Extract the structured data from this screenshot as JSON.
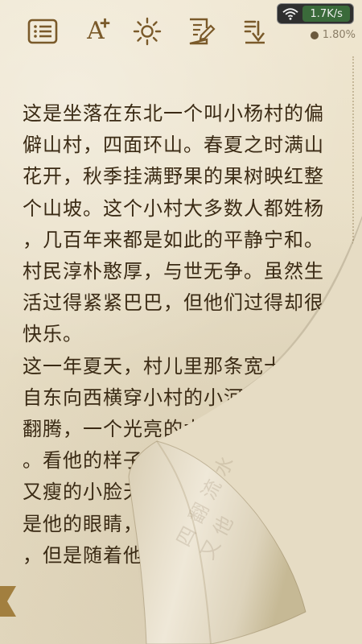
{
  "toolbar": {
    "items": [
      {
        "name": "table-of-contents",
        "icon": "list-icon"
      },
      {
        "name": "font-size",
        "icon": "font-size-icon",
        "label": "A"
      },
      {
        "name": "brightness",
        "icon": "sun-icon"
      },
      {
        "name": "bookmark-notes",
        "icon": "note-edit-icon"
      },
      {
        "name": "download",
        "icon": "download-icon"
      }
    ],
    "accent_color": "#7a5a2a"
  },
  "status": {
    "network_speed": "1.7K/s",
    "reading_progress": "1.80%"
  },
  "reader": {
    "lines": [
      "这是坐落在东北一个叫小杨村的偏",
      "僻山村，四面环山。春夏之时满山",
      "花开，秋季挂满野果的果树映红整",
      "个山坡。这个小村大多数人都姓杨",
      "，几百年来都是如此的平静宁和。",
      "村民淳朴憨厚，与世无争。虽然生",
      "活过得紧紧巴巴，但他们过得却很",
      "快乐。",
      "这一年夏天，村儿里那条宽十多往",
      "自东向西横穿小村的小河，出现在",
      "翻腾，一个光亮的水声。",
      "。看他的样子，从地上看去，",
      "又瘦的小脸天，就是这样的，",
      "是他的眼睛，大，和杨美丽上过床",
      "，但是随着他眼是假。”然后不自"
    ],
    "text_color": "#3a2a14",
    "paper_color": "#e9e0c9"
  }
}
